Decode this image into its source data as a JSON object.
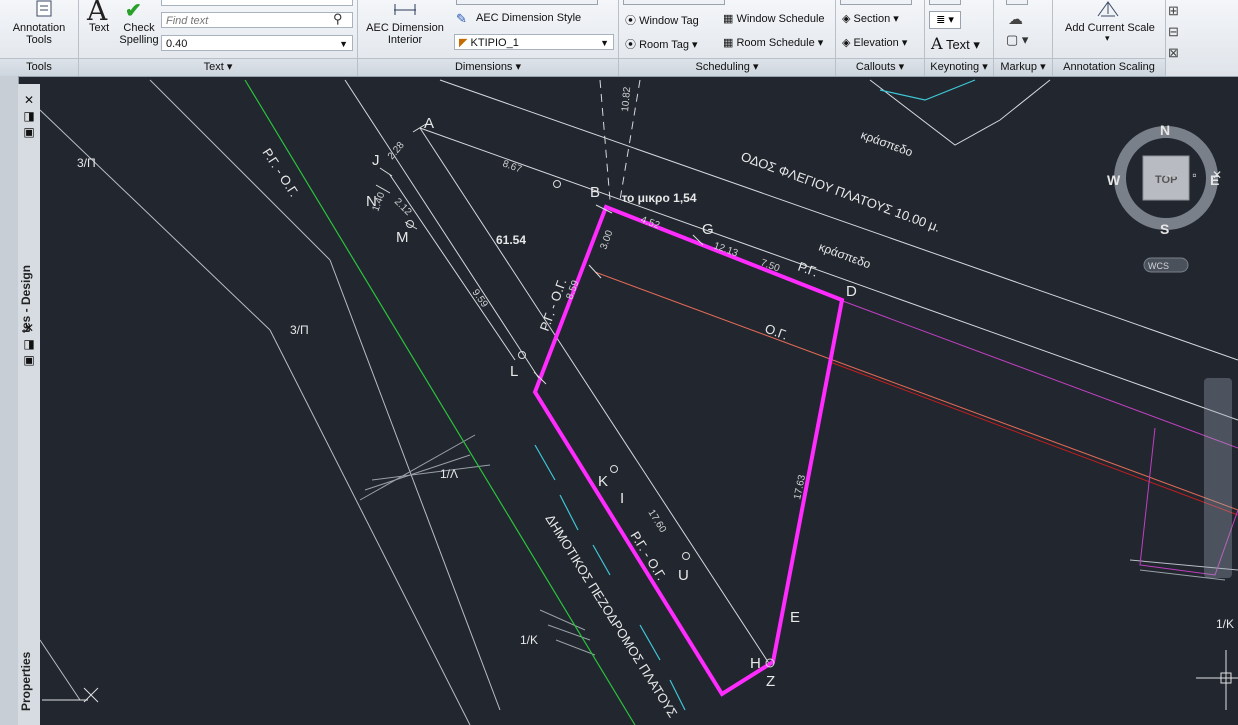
{
  "ribbon": {
    "tools": {
      "annotation_line1": "Annotation",
      "annotation_line2": "Tools",
      "panel": "Tools"
    },
    "text": {
      "text_label": "Text",
      "check_line1": "Check",
      "check_line2": "Spelling",
      "find_placeholder": "Find text",
      "height_value": "0.40",
      "panel": "Text ▾"
    },
    "dimensions": {
      "aec_line1": "AEC Dimension",
      "aec_line2": "Interior",
      "style_label": "AEC Dimension Style",
      "layer_value": "KTIPIO_1",
      "panel": "Dimensions ▾"
    },
    "scheduling": {
      "window_tag": "Window Tag",
      "room_tag": "Room Tag ▾",
      "window_schedule": "Window Schedule",
      "room_schedule": "Room Schedule ▾",
      "panel": "Scheduling ▾"
    },
    "callouts": {
      "section": "Section ▾",
      "elevation": "Elevation ▾",
      "panel": "Callouts ▾"
    },
    "keynoting": {
      "text": "Text ▾",
      "panel": "Keynoting ▾"
    },
    "markup": {
      "panel": "Markup ▾"
    },
    "scaling": {
      "add_scale": "Add Current Scale",
      "panel": "Annotation Scaling"
    }
  },
  "palette": {
    "title_top": "tes - Design",
    "title_bottom": "Properties"
  },
  "viewcube": {
    "n": "N",
    "s": "S",
    "e": "E",
    "w": "W",
    "top": "TOP",
    "wcs": "WCS"
  },
  "drawing": {
    "street": "ΟΔΟΣ ΦΛΕΓΙΟΥ ΠΛΑΤΟΥΣ 10.00 μ.",
    "kraspedo1": "κράσπεδο",
    "kraspedo2": "κράσπεδο",
    "pedestrian": "ΔΗΜΟΤΙΚΟΣ ΠΕΖΟΔΡΟΜΟΣ ΠΛΑΤΟΥΣ",
    "rg_og_left": "Ρ.Γ. - Ο.Γ.",
    "rg_og_plot": "Ρ.Γ. - Ο.Γ.",
    "rg_og_bottom": "Ρ.Γ. - Ο.Γ.",
    "rg": "Ρ.Γ.",
    "og": "Ο.Γ.",
    "note": "το μικρο 1,54",
    "area": "61.54",
    "zone1": "3/Π",
    "zone2": "3/Π",
    "zone3": "1/Λ",
    "zone4": "1/Κ",
    "zone5": "1/Κ",
    "points": {
      "A": "A",
      "B": "B",
      "D": "D",
      "E": "E",
      "G": "G",
      "H": "H",
      "I": "I",
      "J": "J",
      "K": "K",
      "L": "L",
      "M": "M",
      "N": "N",
      "U": "U",
      "Z": "Z"
    },
    "dims": {
      "d1": "8.67",
      "d2": "4.52",
      "d3": "12.13",
      "d4": "7.50",
      "d5": "3.00",
      "d6": "8.59",
      "d7": "9.59",
      "d8": "17.63",
      "d9": "17.60",
      "d10": "2.28",
      "d11": "2.12",
      "d12": "1.40",
      "d13": "10.82"
    }
  }
}
